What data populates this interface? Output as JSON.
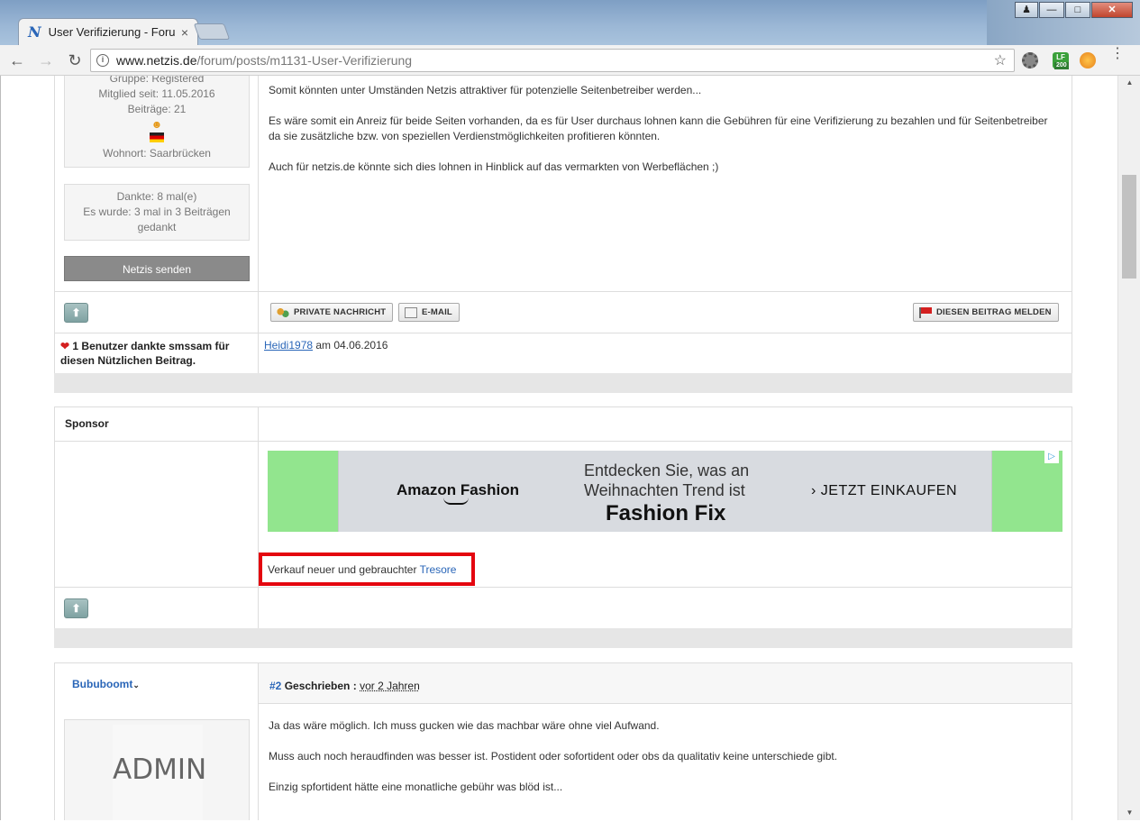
{
  "browser": {
    "tab_title": "User Verifizierung - Forum",
    "tab_close": "×",
    "url_host": "www.netzis.de",
    "url_path": "/forum/posts/m1131-User-Verifizierung",
    "ext_lf_label": "LF",
    "ext_lf_badge": "200"
  },
  "profile1": {
    "group": "Gruppe: Registered",
    "member_since": "Mitglied seit: 11.05.2016",
    "posts": "Beiträge: 21",
    "location": "Wohnort: Saarbrücken"
  },
  "thanks_box": {
    "line1": "Dankte: 8 mal(e)",
    "line2": "Es wurde: 3 mal in 3 Beiträgen",
    "line3": "gedankt"
  },
  "send_button": "Netzis senden",
  "post1": {
    "paragraphs": [
      "Somit könnten unter Umständen Netzis attraktiver für potenzielle Seitenbetreiber werden...",
      "Es wäre somit ein Anreiz für beide Seiten vorhanden, da es für User durchaus lohnen kann die Gebühren für eine Verifizierung zu bezahlen und für Seitenbetreiber",
      "da sie zusätzliche bzw. von speziellen Verdienstmöglichkeiten profitieren könnten.",
      "Auch für netzis.de könnte sich dies lohnen in Hinblick auf das vermarkten von Werbeflächen ;)"
    ]
  },
  "actions": {
    "private_message": "PRIVATE NACHRICHT",
    "email": "E-MAIL",
    "report": "DIESEN BEITRAG MELDEN"
  },
  "thanks_row": {
    "label_line1": "1 Benutzer dankte smssam für",
    "label_line2": "diesen Nützlichen Beitrag.",
    "user": "Heidi1978",
    "date": " am 04.06.2016"
  },
  "sponsor": {
    "label": "Sponsor",
    "ad_brand": "Amazon Fashion",
    "ad_line1": "Entdecken Sie, was an",
    "ad_line2": "Weihnachten Trend ist",
    "ad_line3": "Fashion Fix",
    "ad_cta": "› JETZT EINKAUFEN",
    "ad_choice": "▷",
    "text_prefix": "Verkauf neuer und gebrauchter ",
    "text_link": "Tresore"
  },
  "post2": {
    "author": "Bububoomt",
    "number": "#2",
    "written_label": " Geschrieben : ",
    "time": "vor 2 Jahren",
    "avatar_text": "ADMIN",
    "paragraphs": [
      "Ja das wäre möglich. Ich muss gucken wie das machbar wäre ohne viel Aufwand.",
      "Muss auch noch heraudfinden was besser ist. Postident oder sofortident oder obs da qualitativ keine unterschiede gibt.",
      "Einzig spfortident hätte eine monatliche gebühr was blöd ist..."
    ]
  },
  "colors": {
    "accent_link": "#2a66b8",
    "highlight_red": "#e4060f",
    "ad_green": "#92e58e"
  }
}
